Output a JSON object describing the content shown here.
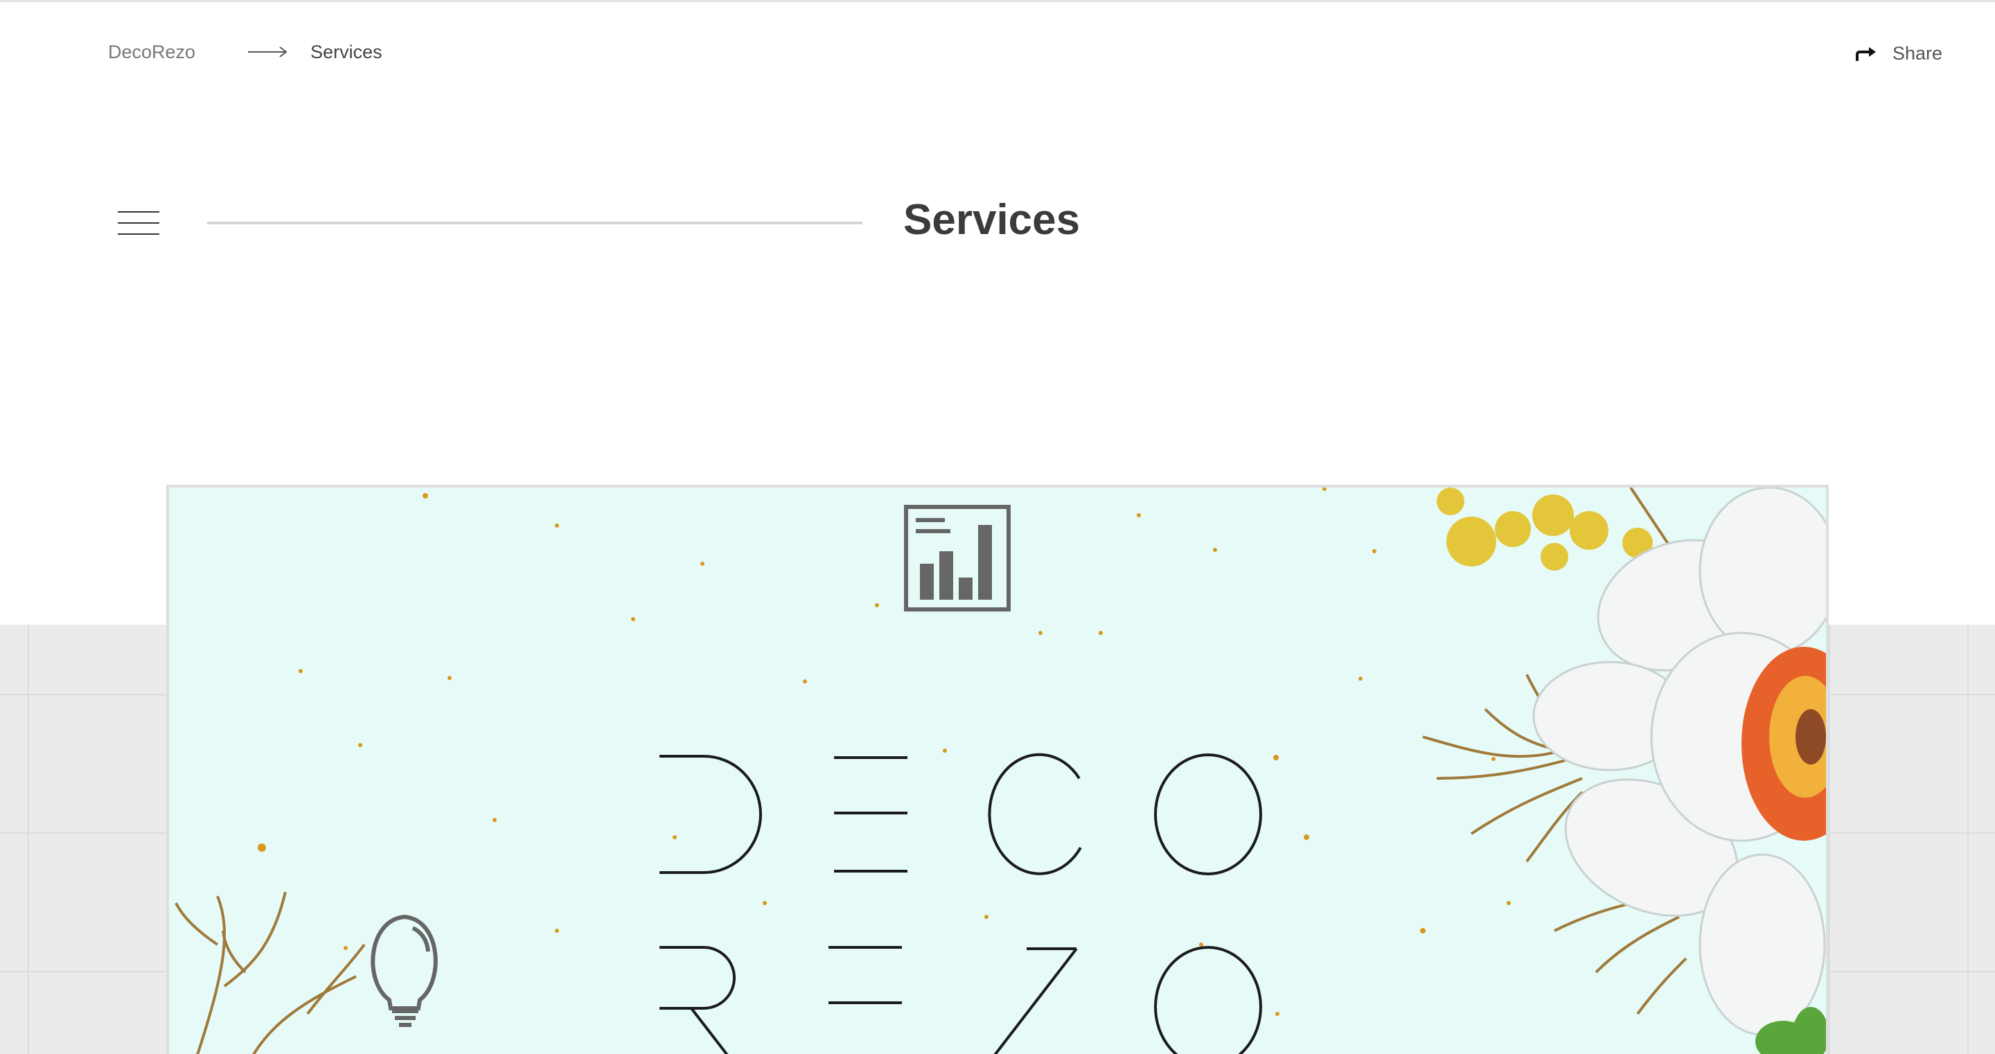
{
  "breadcrumb": {
    "home_label": "DecoRezo",
    "current_label": "Services"
  },
  "share": {
    "label": "Share"
  },
  "page": {
    "title": "Services"
  },
  "hero": {
    "logo_text_line1": "DECO",
    "logo_text_line2": "REZO",
    "background_color": "#e6fbf8",
    "icons": [
      "bar-chart-icon",
      "lightbulb-icon"
    ]
  },
  "colors": {
    "text_dark": "#3b3b3b",
    "text_muted": "#777777",
    "divider": "#d4d4d4",
    "band": "#ebebeb",
    "speckle": "#d69a1e",
    "icon_gray": "#666666"
  }
}
